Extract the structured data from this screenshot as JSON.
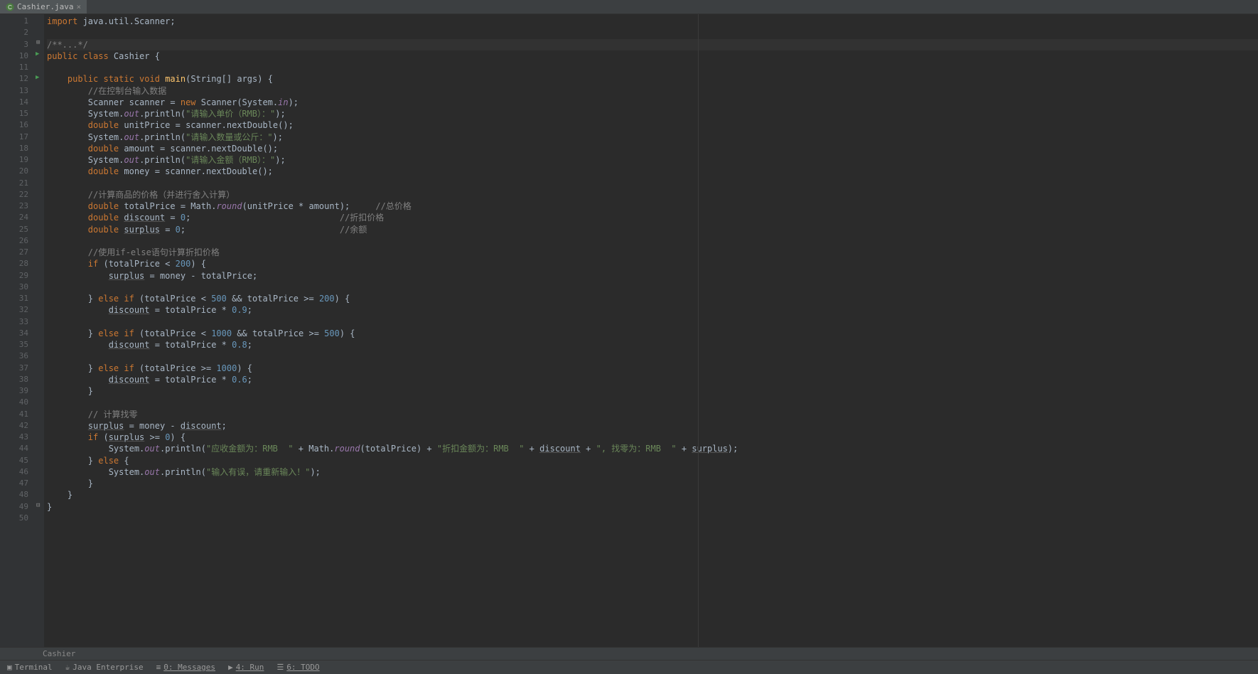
{
  "tab": {
    "filename": "Cashier.java"
  },
  "breadcrumb": "Cashier",
  "bottom": {
    "terminal": "Terminal",
    "javaee": "Java Enterprise",
    "messages": "0: Messages",
    "run": "4: Run",
    "todo": "6: TODO"
  },
  "gutter": {
    "lines": [
      "1",
      "2",
      "3",
      "10",
      "11",
      "12",
      "13",
      "14",
      "15",
      "16",
      "17",
      "18",
      "19",
      "20",
      "21",
      "22",
      "23",
      "24",
      "25",
      "26",
      "27",
      "28",
      "29",
      "30",
      "31",
      "32",
      "33",
      "34",
      "35",
      "36",
      "37",
      "38",
      "39",
      "40",
      "41",
      "42",
      "43",
      "44",
      "45",
      "46",
      "47",
      "48",
      "49",
      "50"
    ]
  },
  "code": {
    "l1": {
      "kw": "import",
      "rest": " java.util.Scanner;"
    },
    "l3": "/**...*/",
    "l10": {
      "p": "public class ",
      "name": "Cashier",
      "b": " {"
    },
    "l12": {
      "a": "    ",
      "p": "public static void ",
      "m": "main",
      "sig": "(String[] args) {"
    },
    "l13": "        //在控制台输入数据",
    "l14": {
      "a": "        Scanner scanner = ",
      "n": "new",
      "b": " Scanner(System.",
      "f": "in",
      "c": ");"
    },
    "l15": {
      "a": "        System.",
      "f": "out",
      "b": ".println(",
      "s": "\"请输入单价（RMB）：\"",
      "c": ");"
    },
    "l16": {
      "a": "        ",
      "k": "double",
      "b": " unitPrice = scanner.nextDouble();"
    },
    "l17": {
      "a": "        System.",
      "f": "out",
      "b": ".println(",
      "s": "\"请输入数量或公斤：\"",
      "c": ");"
    },
    "l18": {
      "a": "        ",
      "k": "double",
      "b": " amount = scanner.nextDouble();"
    },
    "l19": {
      "a": "        System.",
      "f": "out",
      "b": ".println(",
      "s": "\"请输入金额（RMB）：\"",
      "c": ");"
    },
    "l20": {
      "a": "        ",
      "k": "double",
      "b": " money = scanner.nextDouble();"
    },
    "l22": "        //计算商品的价格（并进行舍入计算）",
    "l23": {
      "a": "        ",
      "k": "double",
      "b": " totalPrice = Math.",
      "m": "round",
      "c": "(unitPrice * amount);",
      "cm": "     //总价格"
    },
    "l24": {
      "a": "        ",
      "k": "double",
      "b": " ",
      "u": "discount",
      "c": " = ",
      "n": "0",
      "d": ";",
      "cm": "                             //折扣价格"
    },
    "l25": {
      "a": "        ",
      "k": "double",
      "b": " ",
      "u": "surplus",
      "c": " = ",
      "n": "0",
      "d": ";",
      "cm": "                              //余额"
    },
    "l27": "        //使用if-else语句计算折扣价格",
    "l28": {
      "a": "        ",
      "k": "if",
      "b": " (totalPrice < ",
      "n": "200",
      "c": ") {"
    },
    "l29": {
      "a": "            ",
      "u": "surplus",
      "b": " = money - totalPrice;"
    },
    "l31": {
      "a": "        } ",
      "k": "else if",
      "b": " (totalPrice < ",
      "n1": "500",
      "m": " && totalPrice >= ",
      "n2": "200",
      "c": ") {"
    },
    "l32": {
      "a": "            ",
      "u": "discount",
      "b": " = totalPrice * ",
      "n": "0.9",
      "c": ";"
    },
    "l34": {
      "a": "        } ",
      "k": "else if",
      "b": " (totalPrice < ",
      "n1": "1000",
      "m": " && totalPrice >= ",
      "n2": "500",
      "c": ") {"
    },
    "l35": {
      "a": "            ",
      "u": "discount",
      "b": " = totalPrice * ",
      "n": "0.8",
      "c": ";"
    },
    "l37": {
      "a": "        } ",
      "k": "else if",
      "b": " (totalPrice >= ",
      "n": "1000",
      "c": ") {"
    },
    "l38": {
      "a": "            ",
      "u": "discount",
      "b": " = totalPrice * ",
      "n": "0.6",
      "c": ";"
    },
    "l39": "        }",
    "l41": "        // 计算找零",
    "l42": {
      "a": "        ",
      "u1": "surplus",
      "b": " = money - ",
      "u2": "discount",
      "c": ";"
    },
    "l43": {
      "a": "        ",
      "k": "if",
      "b": " (",
      "u": "surplus",
      "c": " >= ",
      "n": "0",
      "d": ") {"
    },
    "l44": {
      "a": "            System.",
      "f": "out",
      "b": ".println(",
      "s1": "\"应收金额为：RMB  \"",
      "m1": " + Math.",
      "mt": "round",
      "m2": "(totalPrice) + ",
      "s2": "\"折扣金额为：RMB  \"",
      "m3": " + ",
      "u1": "discount",
      "m4": " + ",
      "s3": "\", 找零为：RMB  \"",
      "m5": " + ",
      "u2": "surplus",
      "c": ");"
    },
    "l45": {
      "a": "        } ",
      "k": "else",
      "b": " {"
    },
    "l46": {
      "a": "            System.",
      "f": "out",
      "b": ".println(",
      "s": "\"输入有误，请重新输入！\"",
      "c": ");"
    },
    "l47": "        }",
    "l48": "    }",
    "l49": "}"
  }
}
